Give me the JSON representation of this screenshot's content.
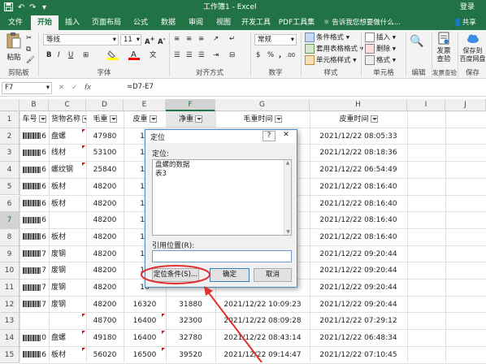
{
  "quick_access": {
    "save_icon": "save-icon",
    "undo": "↶",
    "redo": "↷",
    "more": "▾"
  },
  "title": {
    "text": "工作簿1 - Excel",
    "login": "登录"
  },
  "tabs": [
    "文件",
    "开始",
    "插入",
    "页面布局",
    "公式",
    "数据",
    "审阅",
    "视图",
    "开发工具",
    "PDF工具集"
  ],
  "tell_me": "告诉我您想要做什么...",
  "share": "共享",
  "ribbon": {
    "paste": "粘贴",
    "clipboard": "剪贴板",
    "font_name": "等线",
    "font_size": "11",
    "font_group": "字体",
    "align_group": "对齐方式",
    "number_format": "常规",
    "number_group": "数字",
    "style_items": [
      "条件格式",
      "套用表格格式",
      "单元格样式"
    ],
    "style_group": "样式",
    "cell_items": [
      "插入",
      "删除",
      "格式"
    ],
    "cell_group": "单元格",
    "edit_group": "编辑",
    "invoice_check": [
      "发票",
      "查验"
    ],
    "invoice_group": "发票查验",
    "save_baidu": [
      "保存到",
      "百度网盘"
    ],
    "save_group": "保存"
  },
  "formula_bar": {
    "name_box": "F7",
    "fx": "fx",
    "formula": "=D7-E7"
  },
  "columns": [
    "B",
    "C",
    "D",
    "E",
    "F",
    "G",
    "H",
    "I",
    "J"
  ],
  "rows": [
    {
      "num": "1",
      "b": "车号",
      "c": "货物名称",
      "d": "毛重",
      "e": "皮重",
      "f": "净重",
      "g": "毛重时间",
      "h": "皮重时间",
      "header": true
    },
    {
      "num": "2",
      "b": "6",
      "c": "盘螺",
      "d": "47980",
      "e": "16",
      "f": "",
      "g": "",
      "h": "2021/12/22 08:05:33"
    },
    {
      "num": "3",
      "b": "6",
      "c": "线材",
      "d": "53100",
      "e": "16",
      "f": "",
      "g": "",
      "h": "2021/12/22 08:18:36"
    },
    {
      "num": "4",
      "b": "6",
      "c": "螺纹钢",
      "d": "25840",
      "e": "16",
      "f": "",
      "g": "",
      "h": "2021/12/22 06:54:49"
    },
    {
      "num": "5",
      "b": "6",
      "c": "板材",
      "d": "48200",
      "e": "16",
      "f": "",
      "g": "",
      "h": "2021/12/22 08:16:40"
    },
    {
      "num": "6",
      "b": "6",
      "c": "板材",
      "d": "48200",
      "e": "16",
      "f": "",
      "g": "",
      "h": "2021/12/22 08:16:40"
    },
    {
      "num": "7",
      "b": "6",
      "c": "",
      "d": "48200",
      "e": "16",
      "f": "",
      "g": "",
      "h": "2021/12/22 08:16:40"
    },
    {
      "num": "8",
      "b": "6",
      "c": "板材",
      "d": "48200",
      "e": "16",
      "f": "",
      "g": "",
      "h": "2021/12/22 08:16:40"
    },
    {
      "num": "9",
      "b": "7",
      "c": "废钢",
      "d": "48200",
      "e": "16",
      "f": "",
      "g": "",
      "h": "2021/12/22 09:20:44"
    },
    {
      "num": "10",
      "b": "7",
      "c": "废钢",
      "d": "48200",
      "e": "16",
      "f": "",
      "g": "",
      "h": "2021/12/22 09:20:44"
    },
    {
      "num": "11",
      "b": "7",
      "c": "废钢",
      "d": "48200",
      "e": "16",
      "f": "",
      "g": "",
      "h": "2021/12/22 09:20:44"
    },
    {
      "num": "12",
      "b": "7",
      "c": "废钢",
      "d": "48200",
      "e": "16320",
      "f": "31880",
      "g": "2021/12/22 10:09:23",
      "h": "2021/12/22 09:20:44"
    },
    {
      "num": "13",
      "b": "",
      "c": "",
      "d": "48700",
      "e": "16400",
      "f": "32300",
      "g": "2021/12/22 08:09:28",
      "h": "2021/12/22 07:29:12"
    },
    {
      "num": "14",
      "b": "0",
      "c": "盘螺",
      "d": "49180",
      "e": "16400",
      "f": "32780",
      "g": "2021/12/22 08:43:14",
      "h": "2021/12/22 06:48:34"
    },
    {
      "num": "15",
      "b": "6",
      "c": "板材",
      "d": "56020",
      "e": "16500",
      "f": "39520",
      "g": "2021/12/22 09:14:47",
      "h": "2021/12/22 07:10:45"
    }
  ],
  "dialog": {
    "title": "定位",
    "help": "?",
    "close": "✕",
    "goto_label": "定位:",
    "list_items": [
      "盘螺的数据",
      "表3"
    ],
    "ref_label": "引用位置(R):",
    "ref_value": "",
    "special_button": "定位条件(S)...",
    "ok_button": "确定",
    "cancel_button": "取消"
  },
  "colors": {
    "excel_green": "#217346",
    "annotation_red": "#e03030",
    "selection_blue": "#4b88c7"
  }
}
